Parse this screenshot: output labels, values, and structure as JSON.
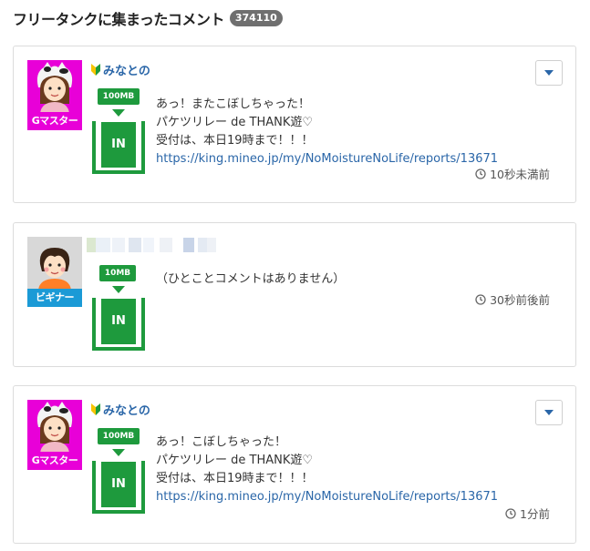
{
  "header": {
    "title": "フリータンクに集まったコメント",
    "count": "374110"
  },
  "icons": {
    "dropdown": "caret-down-icon",
    "clock": "clock-icon",
    "leaf": "beginner-leaf-icon"
  },
  "colors": {
    "tank_green": "#1e9a3d",
    "link_blue": "#2a66a8",
    "gmaster_magenta": "#e800d8",
    "beginner_blue": "#1b9ad6"
  },
  "comments": [
    {
      "user_name": "みなとの",
      "rank": "Gマスター",
      "tank_amount": "100MB",
      "tank_direction": "IN",
      "lines": [
        "あっ！またこぼしちゃった！",
        "パケツリレー de THANK遊♡",
        "受付は、本日19時まで！！！"
      ],
      "link": "https://king.mineo.jp/my/NoMoistureNoLife/reports/13671",
      "time": "10秒未満前"
    },
    {
      "rank": "ビギナー",
      "tank_amount": "10MB",
      "tank_direction": "IN",
      "lines": [
        "（ひとことコメントはありません）"
      ],
      "time": "30秒前後前"
    },
    {
      "user_name": "みなとの",
      "rank": "Gマスター",
      "tank_amount": "100MB",
      "tank_direction": "IN",
      "lines": [
        "あっ！こぼしちゃった！",
        "パケツリレー de THANK遊♡",
        "受付は、本日19時まで！！！"
      ],
      "link": "https://king.mineo.jp/my/NoMoistureNoLife/reports/13671",
      "time": "1分前"
    }
  ]
}
